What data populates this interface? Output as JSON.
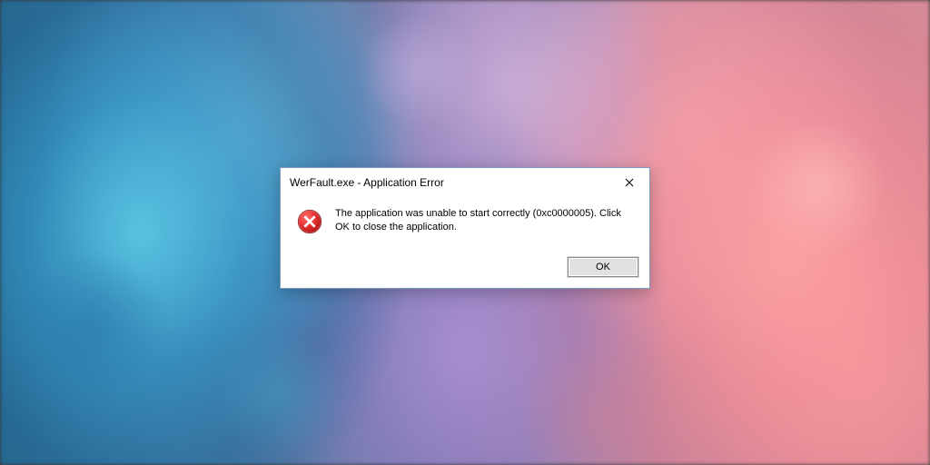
{
  "dialog": {
    "title": "WerFault.exe - Application Error",
    "message": "The application was unable to start correctly (0xc0000005). Click OK to close the application.",
    "ok_label": "OK"
  }
}
